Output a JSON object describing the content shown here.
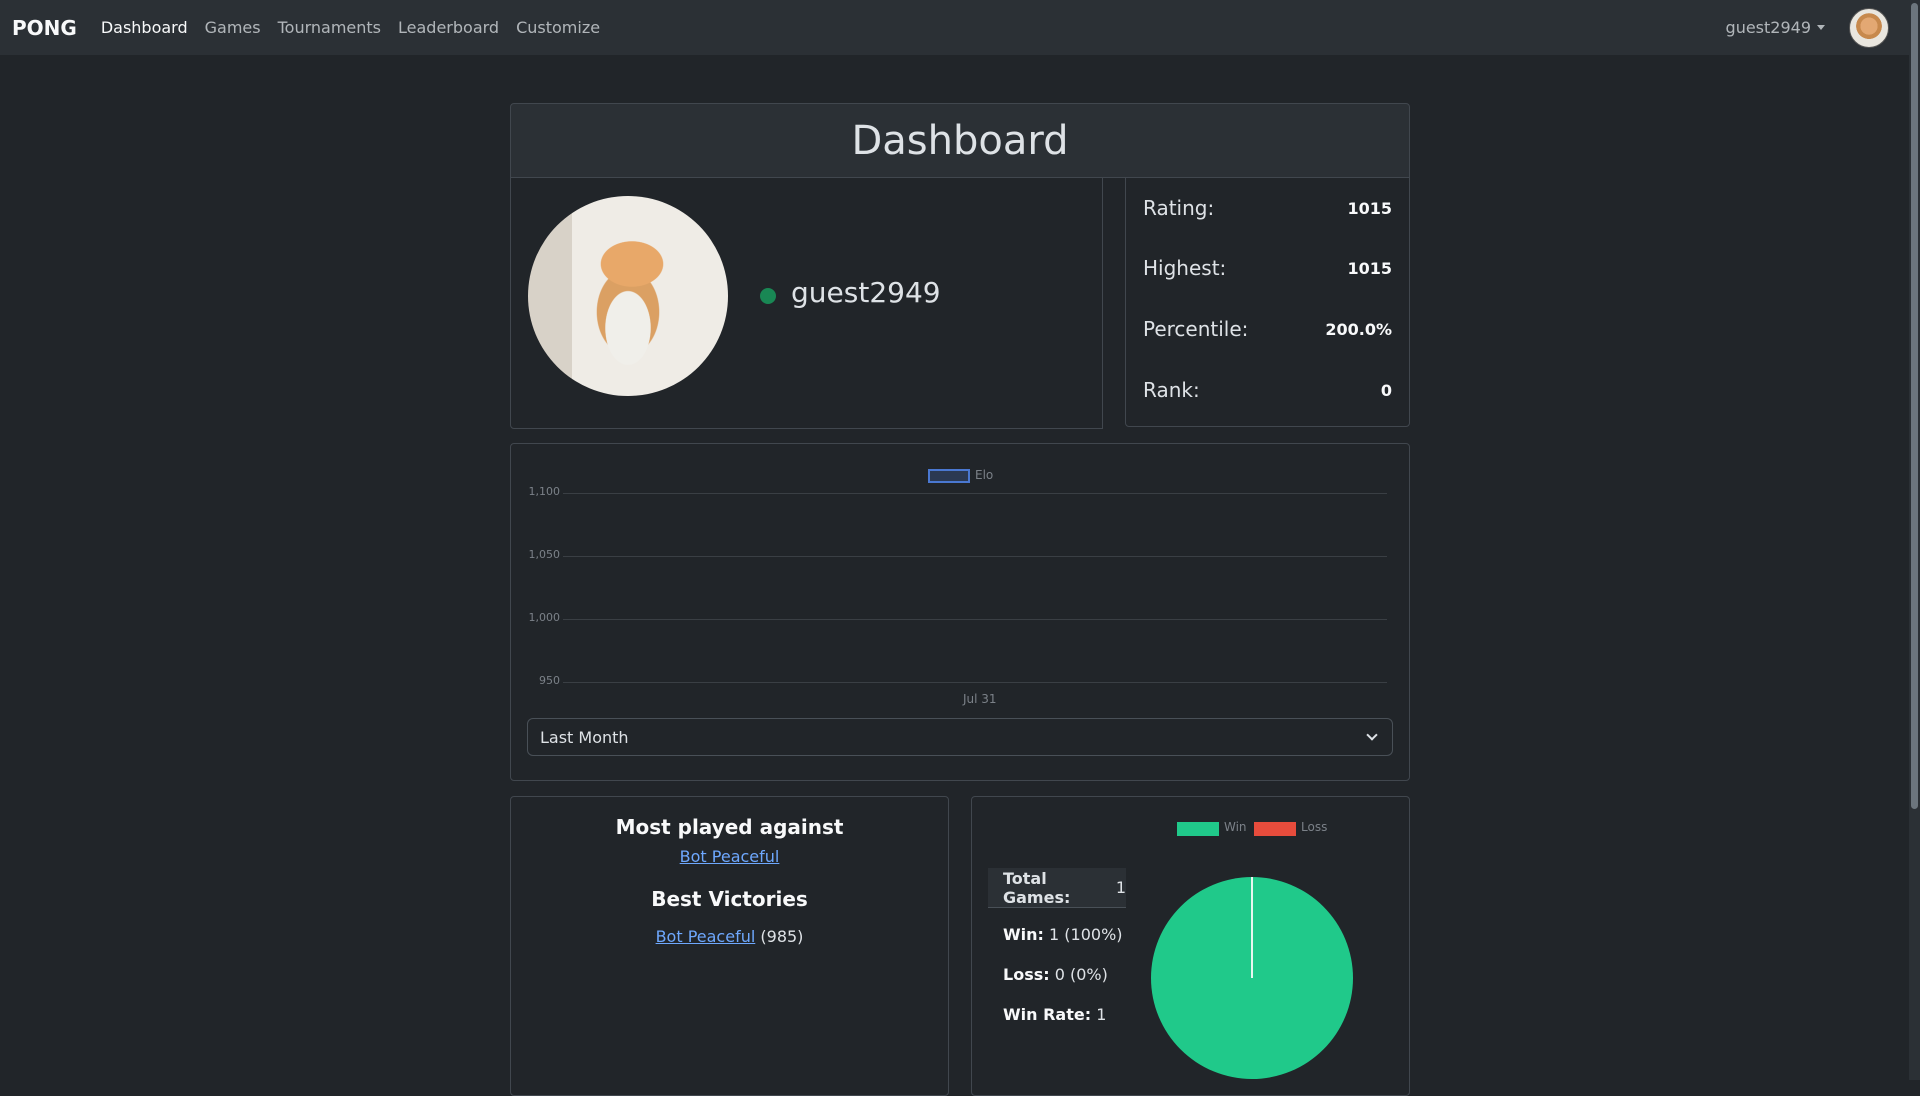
{
  "nav": {
    "brand": "PONG",
    "links": [
      "Dashboard",
      "Games",
      "Tournaments",
      "Leaderboard",
      "Customize"
    ],
    "user": "guest2949"
  },
  "page": {
    "title": "Dashboard"
  },
  "profile": {
    "username": "guest2949",
    "status_color": "#198754"
  },
  "stats": {
    "rating_label": "Rating:",
    "rating": "1015",
    "highest_label": "Highest:",
    "highest": "1015",
    "percentile_label": "Percentile:",
    "percentile": "200.0%",
    "rank_label": "Rank:",
    "rank": "0"
  },
  "elo_chart": {
    "legend": "Elo",
    "y_ticks": [
      "1,100",
      "1,050",
      "1,000",
      "950"
    ],
    "x_tick": "Jul 31",
    "range_select": "Last Month"
  },
  "opponents": {
    "most_played_title": "Most played against",
    "most_played": "Bot Peaceful",
    "best_victories_title": "Best Victories",
    "best_victory_name": "Bot Peaceful",
    "best_victory_rating": "(985)"
  },
  "games": {
    "legend_win": "Win",
    "legend_loss": "Loss",
    "total_label": "Total Games:",
    "total_value": "1",
    "win_label": "Win:",
    "win_value": "1 (100%)",
    "loss_label": "Loss:",
    "loss_value": "0 (0%)",
    "winrate_label": "Win Rate:",
    "winrate_value": "1"
  },
  "chart_data": [
    {
      "type": "line",
      "series": [
        {
          "name": "Elo",
          "values": []
        }
      ],
      "x": [
        "Jul 31"
      ],
      "y_ticks": [
        950,
        1000,
        1050,
        1100
      ],
      "ylim": [
        950,
        1100
      ],
      "legend_position": "top",
      "grid": true
    },
    {
      "type": "pie",
      "categories": [
        "Win",
        "Loss"
      ],
      "values": [
        1,
        0
      ],
      "colors": [
        "#20c98a",
        "#e74c3c"
      ],
      "legend_position": "top"
    }
  ]
}
